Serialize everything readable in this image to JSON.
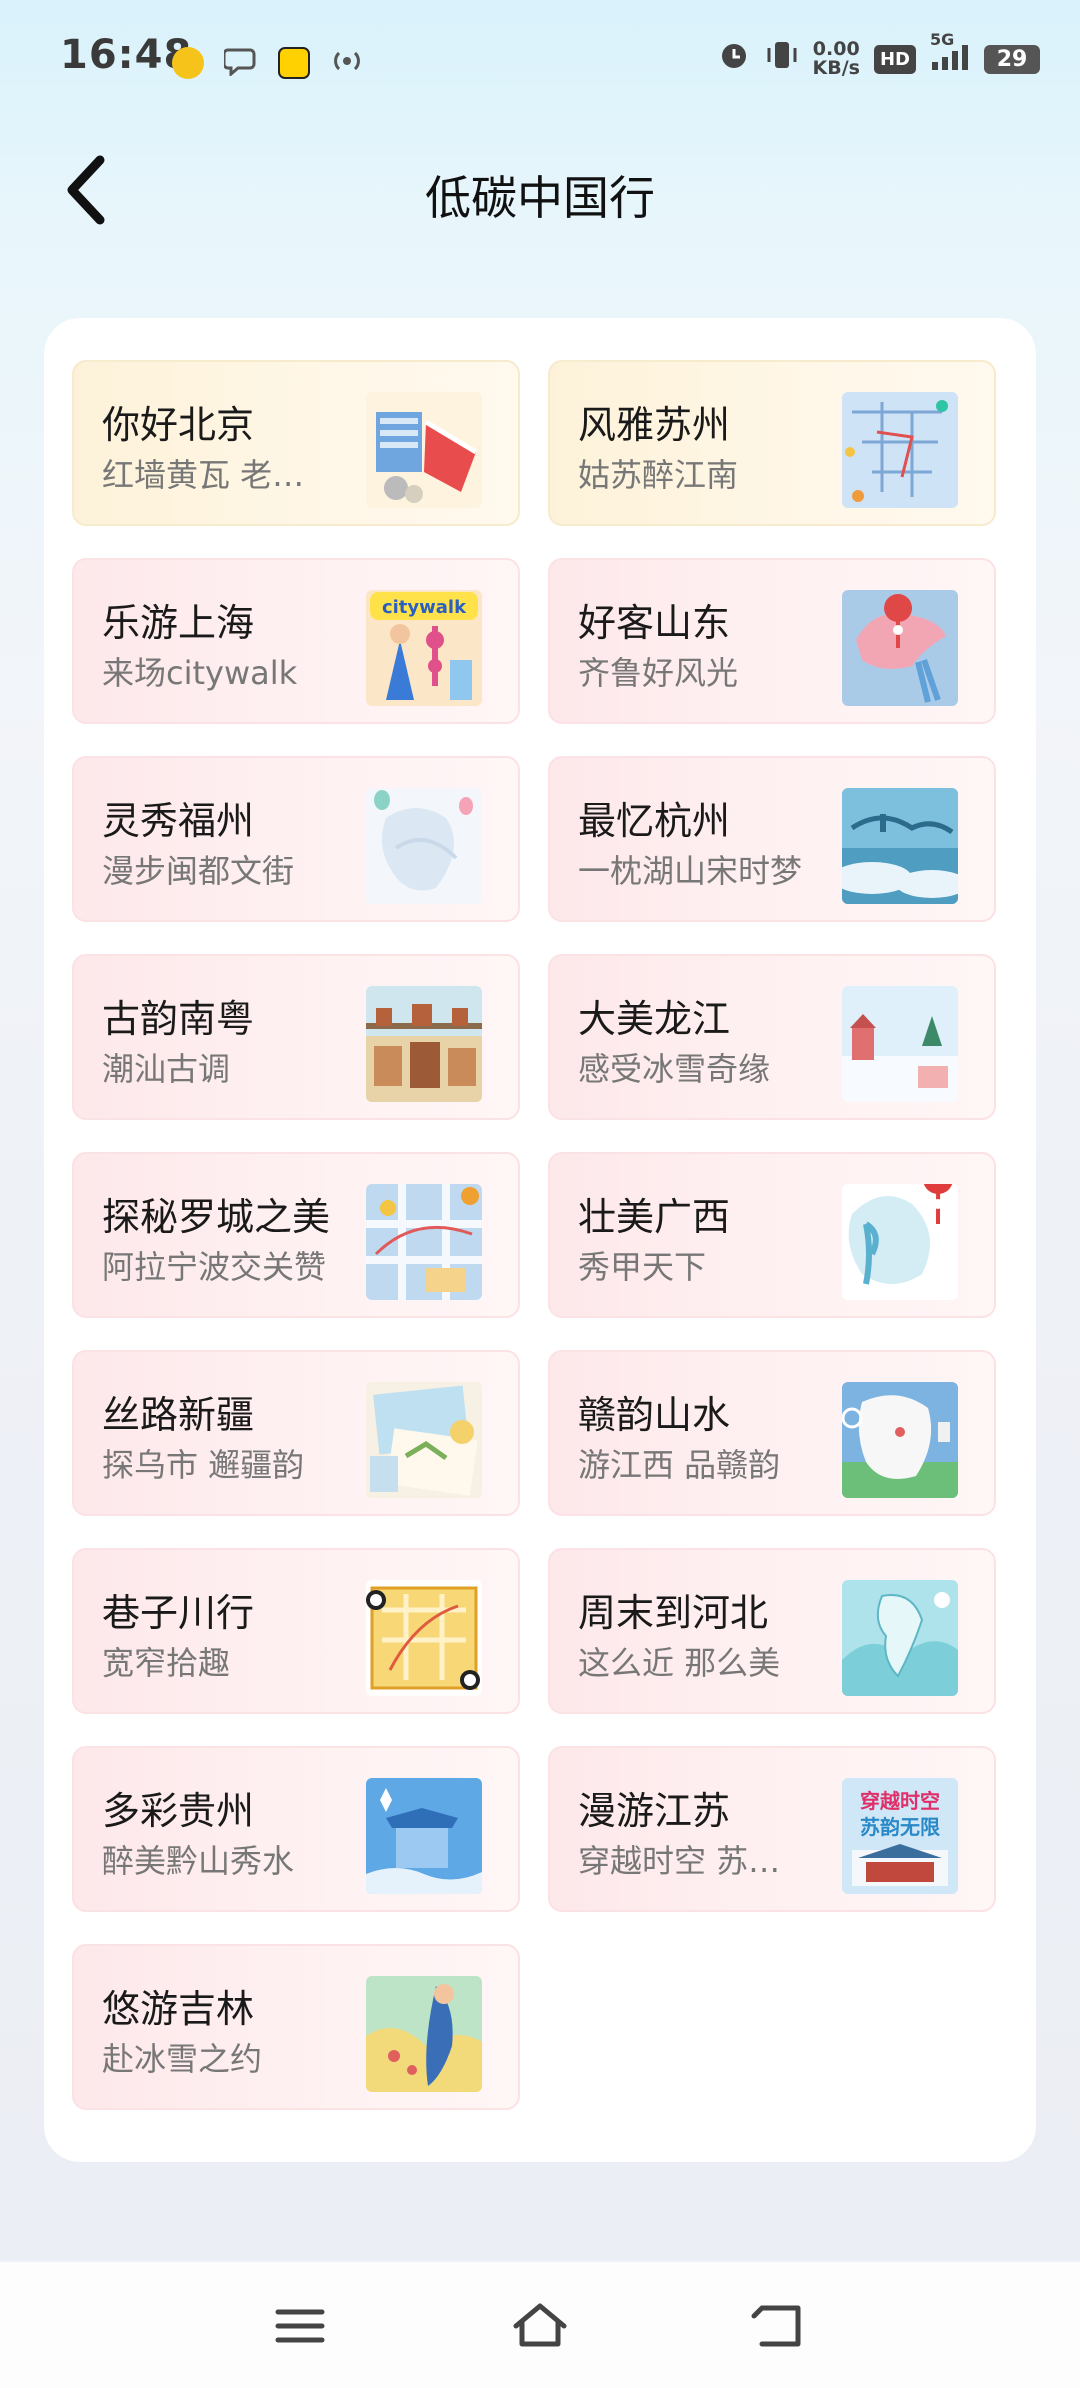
{
  "status_bar": {
    "time": "16:48",
    "net_speed_value": "0.00",
    "net_speed_unit": "KB/s",
    "hd_label": "HD",
    "network_label": "5G",
    "battery": "29"
  },
  "header": {
    "title": "低碳中国行"
  },
  "cards": [
    {
      "title": "你好北京",
      "subtitle": "红墙黄瓦 老…",
      "style": "gold",
      "thumb": "beijing-thumbnail"
    },
    {
      "title": "风雅苏州",
      "subtitle": "姑苏醉江南",
      "style": "gold",
      "thumb": "suzhou-thumbnail"
    },
    {
      "title": "乐游上海",
      "subtitle": "来场citywalk",
      "style": "pink",
      "thumb": "shanghai-thumbnail"
    },
    {
      "title": "好客山东",
      "subtitle": "齐鲁好风光",
      "style": "pink",
      "thumb": "shandong-thumbnail"
    },
    {
      "title": "灵秀福州",
      "subtitle": "漫步闽都文街",
      "style": "pink",
      "thumb": "fuzhou-thumbnail"
    },
    {
      "title": "最忆杭州",
      "subtitle": "一枕湖山宋时梦",
      "style": "pink",
      "thumb": "hangzhou-thumbnail"
    },
    {
      "title": "古韵南粤",
      "subtitle": "潮汕古调",
      "style": "pink",
      "thumb": "nanyue-thumbnail"
    },
    {
      "title": "大美龙江",
      "subtitle": "感受冰雪奇缘",
      "style": "pink",
      "thumb": "longjiang-thumbnail"
    },
    {
      "title": "探秘罗城之美",
      "subtitle": "阿拉宁波交关赞",
      "style": "pink",
      "thumb": "ningbo-thumbnail"
    },
    {
      "title": "壮美广西",
      "subtitle": "秀甲天下",
      "style": "pink",
      "thumb": "guangxi-thumbnail"
    },
    {
      "title": "丝路新疆",
      "subtitle": "探乌市 邂疆韵",
      "style": "pink",
      "thumb": "xinjiang-thumbnail"
    },
    {
      "title": "赣韵山水",
      "subtitle": "游江西 品赣韵",
      "style": "pink",
      "thumb": "jiangxi-thumbnail"
    },
    {
      "title": "巷子川行",
      "subtitle": "宽窄拾趣",
      "style": "pink",
      "thumb": "sichuan-thumbnail"
    },
    {
      "title": "周末到河北",
      "subtitle": "这么近 那么美",
      "style": "pink",
      "thumb": "hebei-thumbnail"
    },
    {
      "title": "多彩贵州",
      "subtitle": "醉美黔山秀水",
      "style": "pink",
      "thumb": "guizhou-thumbnail"
    },
    {
      "title": "漫游江苏",
      "subtitle": "穿越时空 苏…",
      "style": "pink",
      "thumb": "jiangsu-thumbnail"
    },
    {
      "title": "悠游吉林",
      "subtitle": "赴冰雪之约",
      "style": "pink",
      "thumb": "jilin-thumbnail"
    }
  ],
  "thumbnail_text": {
    "shanghai": "citywalk",
    "jiangsu_line1": "穿越时空",
    "jiangsu_line2": "苏韵无限"
  },
  "nav_bar": {
    "menu_icon": "menu-icon",
    "home_icon": "home-icon",
    "back_icon": "back-icon"
  }
}
